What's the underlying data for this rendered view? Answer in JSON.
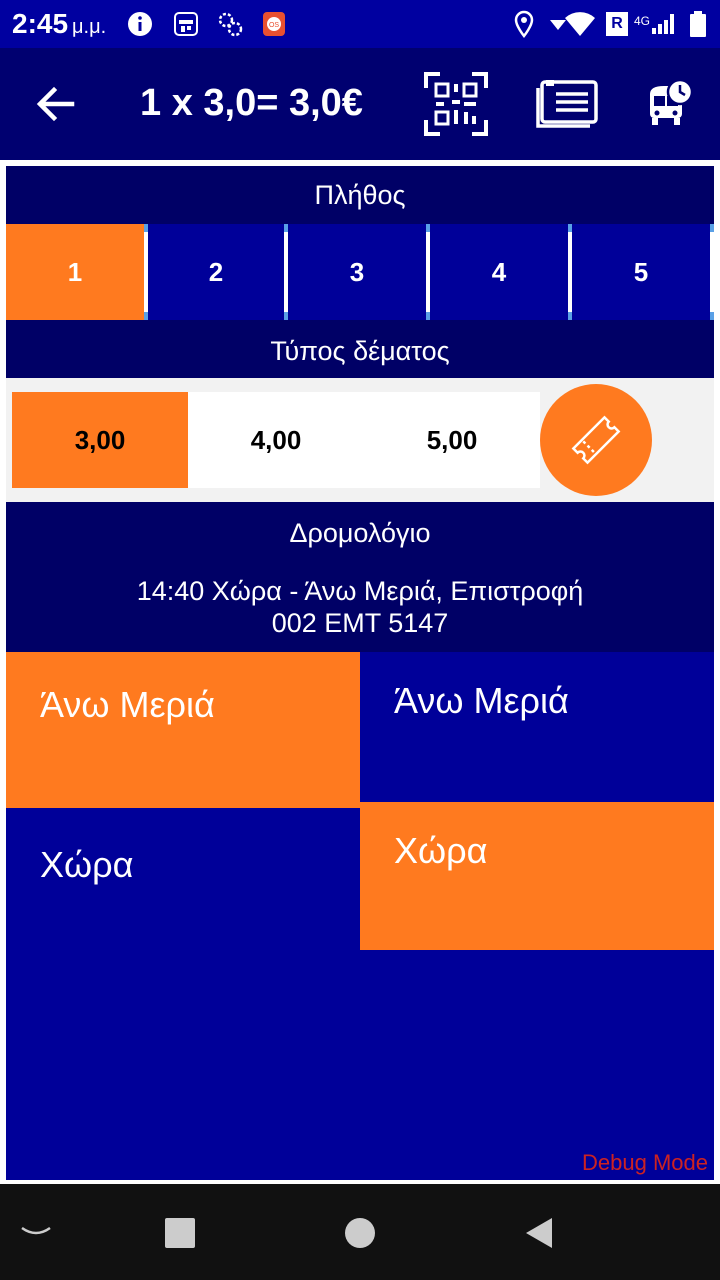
{
  "status_bar": {
    "time": "2:45",
    "ampm": "μ.μ.",
    "network": "4G",
    "roaming": "R"
  },
  "toolbar": {
    "title": "1 x 3,0= 3,0€"
  },
  "quantity": {
    "title": "Πλήθος",
    "options": [
      "1",
      "2",
      "3",
      "4",
      "5"
    ],
    "selected_index": 0
  },
  "package": {
    "title": "Τύπος δέματος",
    "options": [
      "3,00",
      "4,00",
      "5,00"
    ],
    "selected_index": 0
  },
  "route": {
    "title": "Δρομολόγιο",
    "line1": "14:40 Χώρα - Άνω Μεριά, Επιστροφή",
    "line2": "002 ΕΜΤ 5147",
    "from_stops": [
      "Άνω Μεριά",
      "Χώρα"
    ],
    "to_stops": [
      "Άνω Μεριά",
      "Χώρα"
    ]
  },
  "debug_label": "Debug Mode",
  "colors": {
    "accent": "#ff7a1f",
    "primary": "#000099",
    "dark": "#000066"
  }
}
